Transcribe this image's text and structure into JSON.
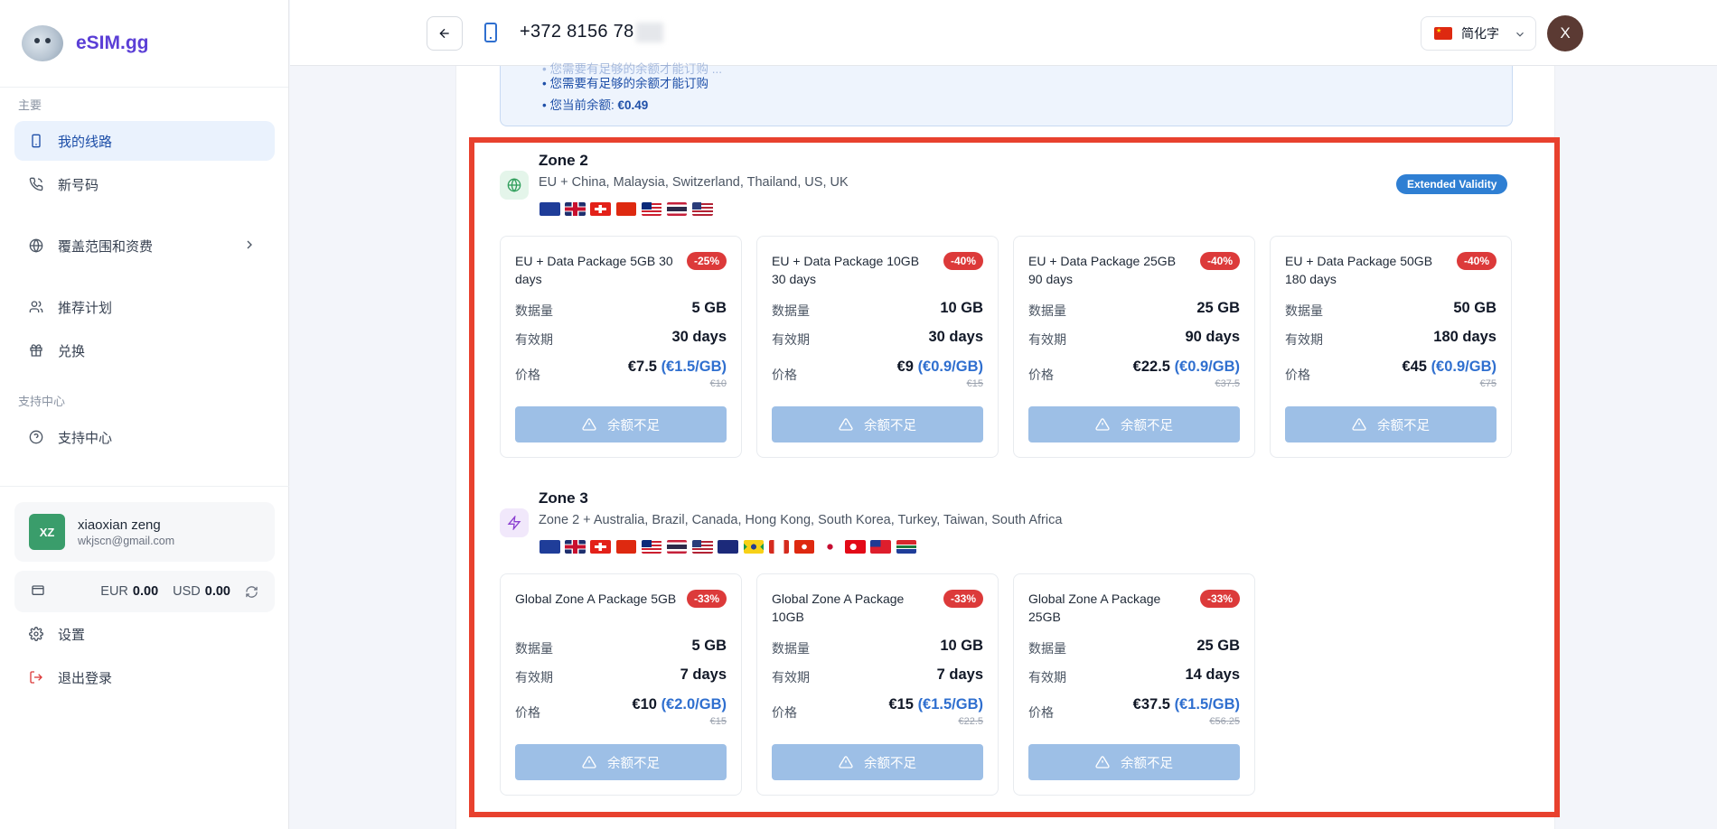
{
  "brand": {
    "name": "eSIM.gg"
  },
  "sidebar": {
    "section_main": "主要",
    "items": [
      {
        "label": "我的线路",
        "icon": "phone-icon",
        "active": true
      },
      {
        "label": "新号码",
        "icon": "phone-call-icon"
      },
      {
        "label": "覆盖范围和资费",
        "icon": "globe-icon"
      },
      {
        "label": "推荐计划",
        "icon": "users-icon"
      },
      {
        "label": "兑换",
        "icon": "gift-icon"
      }
    ],
    "section_support": "支持中心",
    "support_item": {
      "label": "支持中心",
      "icon": "help-circle-icon"
    },
    "user": {
      "initials": "XZ",
      "name": "xiaoxian zeng",
      "email": "wkjscn@gmail.com"
    },
    "wallet": {
      "eur_label": "EUR",
      "eur_value": "0.00",
      "usd_label": "USD",
      "usd_value": "0.00"
    },
    "settings_label": "设置",
    "logout_label": "退出登录"
  },
  "topbar": {
    "phone_number": "+372 8156 78",
    "language": "简化字",
    "avatar_initial": "X"
  },
  "notice": {
    "faint_line": "• 您需要有足够的余额才能订购 ...",
    "line1": "• 您需要有足够的余额才能订购",
    "balance_prefix": "• 您当前余额: ",
    "balance_value": "€0.49"
  },
  "zones": [
    {
      "title": "Zone 2",
      "description": "EU + China, Malaysia, Switzerland, Thailand, US, UK",
      "badge": "Extended Validity",
      "flags": [
        "eu",
        "uk",
        "ch",
        "cn",
        "my",
        "th",
        "us"
      ],
      "packages": [
        {
          "name": "EU + Data Package 5GB 30 days",
          "discount": "-25%",
          "data_label": "数据量",
          "data": "5 GB",
          "validity_label": "有效期",
          "validity": "30 days",
          "price_label": "价格",
          "price": "€7.5",
          "per_gb": "(€1.5/GB)",
          "old_price": "€10",
          "button": "余额不足"
        },
        {
          "name": "EU + Data Package 10GB 30 days",
          "discount": "-40%",
          "data_label": "数据量",
          "data": "10 GB",
          "validity_label": "有效期",
          "validity": "30 days",
          "price_label": "价格",
          "price": "€9",
          "per_gb": "(€0.9/GB)",
          "old_price": "€15",
          "button": "余额不足"
        },
        {
          "name": "EU + Data Package 25GB 90 days",
          "discount": "-40%",
          "data_label": "数据量",
          "data": "25 GB",
          "validity_label": "有效期",
          "validity": "90 days",
          "price_label": "价格",
          "price": "€22.5",
          "per_gb": "(€0.9/GB)",
          "old_price": "€37.5",
          "button": "余额不足"
        },
        {
          "name": "EU + Data Package 50GB 180 days",
          "discount": "-40%",
          "data_label": "数据量",
          "data": "50 GB",
          "validity_label": "有效期",
          "validity": "180 days",
          "price_label": "价格",
          "price": "€45",
          "per_gb": "(€0.9/GB)",
          "old_price": "€75",
          "button": "余额不足"
        }
      ]
    },
    {
      "title": "Zone 3",
      "description": "Zone 2 + Australia, Brazil, Canada, Hong Kong, South Korea, Turkey, Taiwan, South Africa",
      "flags": [
        "eu",
        "uk",
        "ch",
        "cn",
        "my",
        "th",
        "us",
        "au",
        "br",
        "ca",
        "hk",
        "kr",
        "tr",
        "tw",
        "za"
      ],
      "packages": [
        {
          "name": "Global Zone A Package 5GB",
          "discount": "-33%",
          "data_label": "数据量",
          "data": "5 GB",
          "validity_label": "有效期",
          "validity": "7 days",
          "price_label": "价格",
          "price": "€10",
          "per_gb": "(€2.0/GB)",
          "old_price": "€15",
          "button": "余额不足"
        },
        {
          "name": "Global Zone A Package 10GB",
          "discount": "-33%",
          "data_label": "数据量",
          "data": "10 GB",
          "validity_label": "有效期",
          "validity": "7 days",
          "price_label": "价格",
          "price": "€15",
          "per_gb": "(€1.5/GB)",
          "old_price": "€22.5",
          "button": "余额不足"
        },
        {
          "name": "Global Zone A Package 25GB",
          "discount": "-33%",
          "data_label": "数据量",
          "data": "25 GB",
          "validity_label": "有效期",
          "validity": "14 days",
          "price_label": "价格",
          "price": "€37.5",
          "per_gb": "(€1.5/GB)",
          "old_price": "€56.25",
          "button": "余额不足"
        }
      ]
    }
  ],
  "colors": {
    "accent": "#2f6fcf",
    "highlight": "#e8412e",
    "discount": "#dc3a3a",
    "disabled_button": "#9dbfe6"
  }
}
